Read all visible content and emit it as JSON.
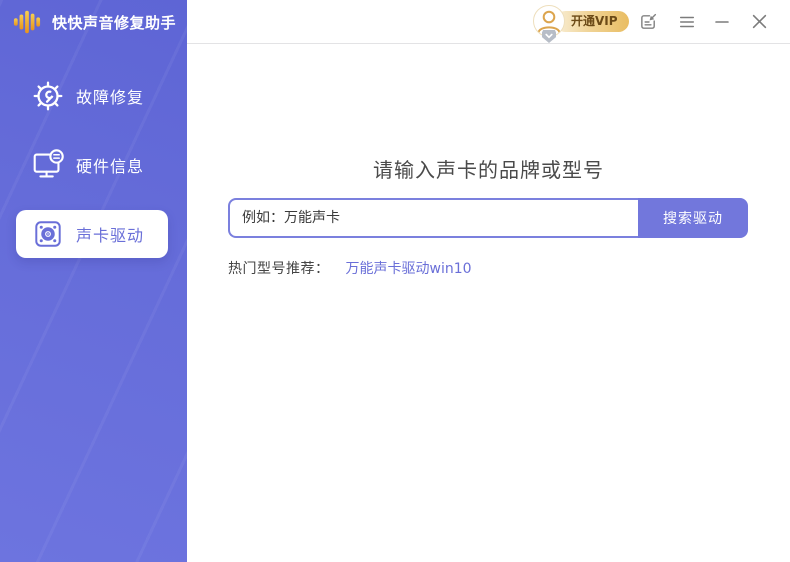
{
  "window": {
    "title": "快快声音修复助手",
    "vip_label": "开通VIP",
    "controls": {
      "feedback": "feedback",
      "menu": "menu",
      "minimize": "minimize",
      "close": "close"
    }
  },
  "sidebar": {
    "items": [
      {
        "label": "故障修复",
        "icon": "gear-wrench-icon",
        "active": false
      },
      {
        "label": "硬件信息",
        "icon": "hardware-info-icon",
        "active": false
      },
      {
        "label": "声卡驱动",
        "icon": "sound-card-icon",
        "active": true
      }
    ]
  },
  "main": {
    "heading": "请输入声卡的品牌或型号",
    "search_placeholder": "例如：万能声卡",
    "search_button": "搜索驱动",
    "hot_label": "热门型号推荐：",
    "hot_link": "万能声卡驱动win10"
  },
  "colors": {
    "accent": "#6a6fd8",
    "sidebar_top": "#5e65d5",
    "sidebar_bottom": "#6d74df",
    "search_button_bg": "#7277dc",
    "input_border": "#7b80de",
    "link": "#6a6fd8",
    "vip_text": "#6b4a17",
    "vip_gradient_start": "#f9efd7",
    "vip_gradient_end": "#e9bd62",
    "window_icon_gray": "#828282",
    "heading_text": "#4a4a4a"
  }
}
